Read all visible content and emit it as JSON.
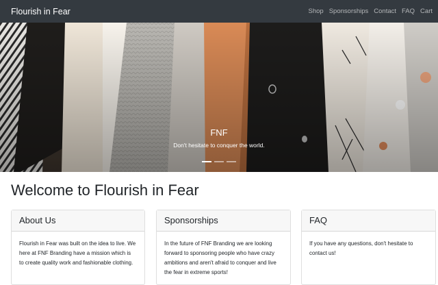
{
  "navbar": {
    "brand": "Flourish in Fear",
    "links": [
      "Shop",
      "Sponsorships",
      "Contact",
      "FAQ",
      "Cart"
    ]
  },
  "carousel": {
    "title": "FNF",
    "text": "Don't hesitate to conquer the world.",
    "slide_count": 3,
    "active_slide": 1
  },
  "main": {
    "heading": "Welcome to Flourish in Fear",
    "cards": [
      {
        "title": "About Us",
        "body": "Flourish in Fear was built on the idea to live. We here at FNF Branding have a mission which is to create quality work and fashionable clothing."
      },
      {
        "title": "Sponsorships",
        "body": "In the future of FNF Branding we are looking forward to sponsoring people who have crazy ambitions and aren't afraid to conquer and live the fear in extreme sports!"
      },
      {
        "title": "FAQ",
        "body": "If you have any questions, don't hesitate to contact us!"
      }
    ]
  },
  "colors": {
    "navbar_bg": "#343a40",
    "card_header_bg": "#f7f7f7"
  }
}
